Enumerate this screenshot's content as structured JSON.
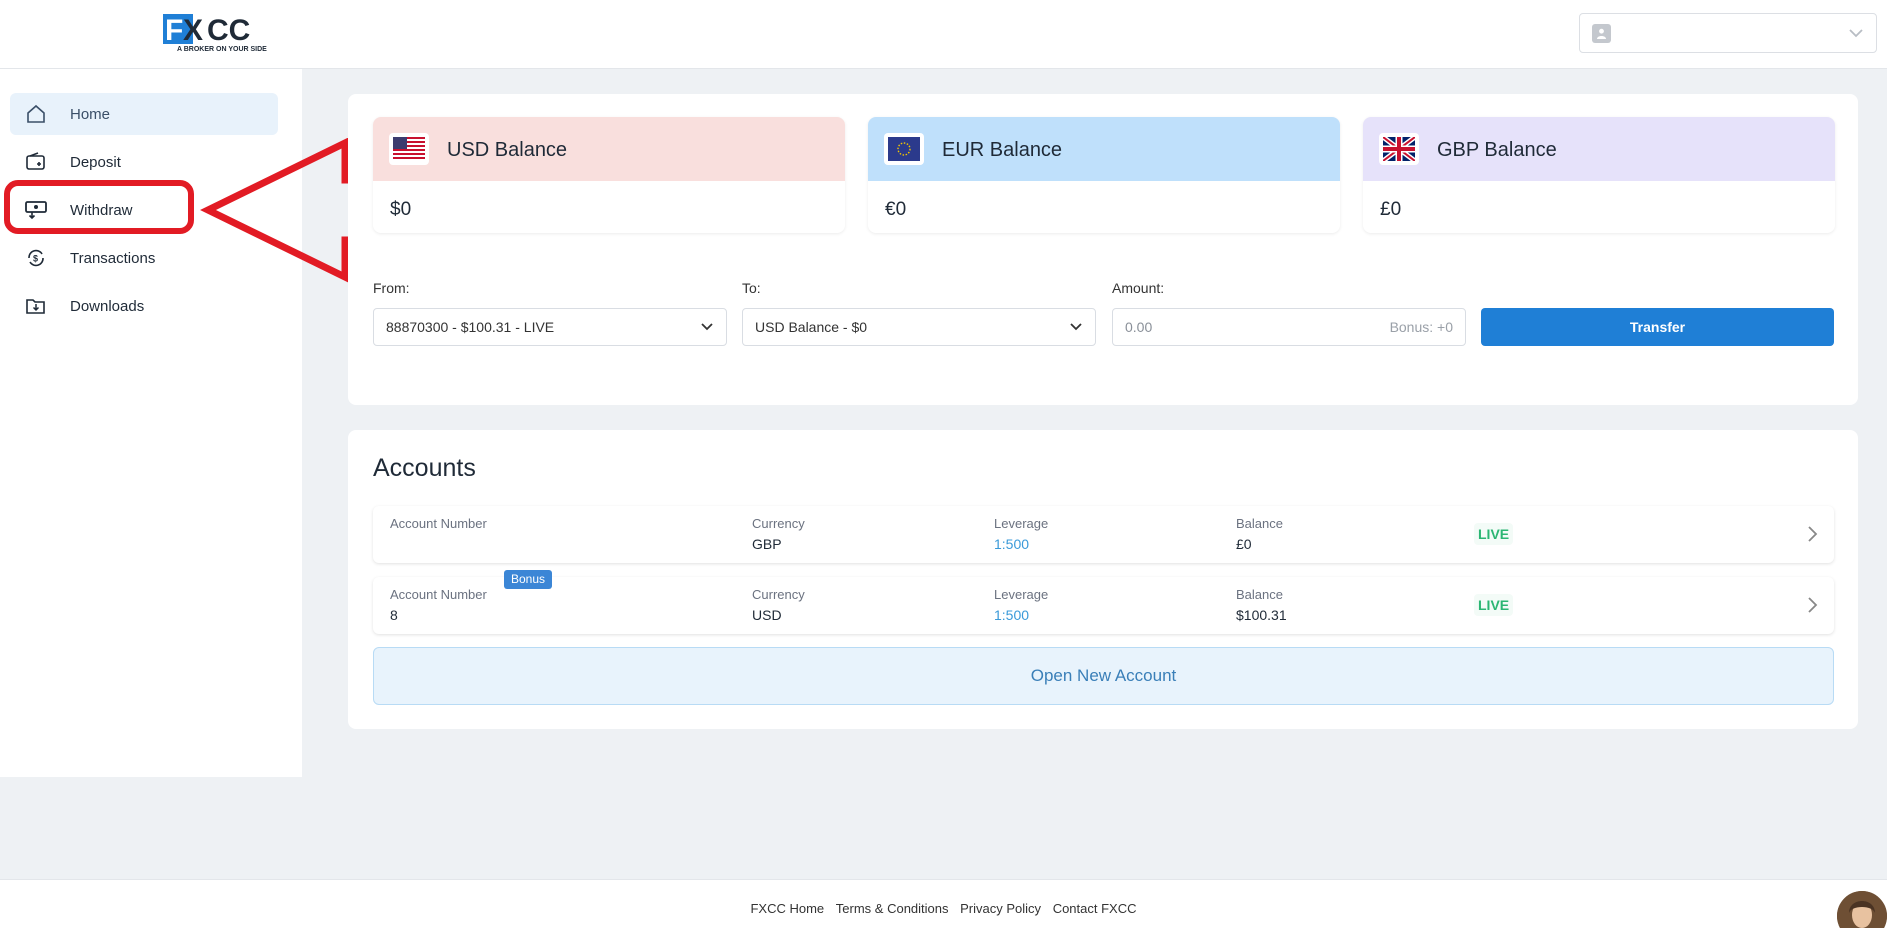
{
  "brand": {
    "logo_text": "FXCC",
    "tagline": "A BROKER ON YOUR SIDE",
    "primary_color": "#1f7fd6"
  },
  "sidebar": {
    "items": [
      {
        "label": "Home",
        "icon": "home-icon",
        "active": true
      },
      {
        "label": "Deposit",
        "icon": "wallet-icon",
        "active": false
      },
      {
        "label": "Withdraw",
        "icon": "withdraw-icon",
        "active": false
      },
      {
        "label": "Transactions",
        "icon": "transactions-icon",
        "active": false
      },
      {
        "label": "Downloads",
        "icon": "download-folder-icon",
        "active": false
      }
    ]
  },
  "balances": [
    {
      "title": "USD Balance",
      "value": "$0",
      "flag": "us-flag-icon",
      "color": "#f9dfdd"
    },
    {
      "title": "EUR Balance",
      "value": "€0",
      "flag": "eu-flag-icon",
      "color": "#bfe0fb"
    },
    {
      "title": "GBP Balance",
      "value": "£0",
      "flag": "uk-flag-icon",
      "color": "#e6e2fa"
    }
  ],
  "transfer": {
    "from_label": "From:",
    "from_value": "88870300 - $100.31 - LIVE",
    "to_label": "To:",
    "to_value": "USD Balance - $0",
    "amount_label": "Amount:",
    "amount_placeholder": "0.00",
    "bonus_text": "Bonus: +0",
    "button_label": "Transfer"
  },
  "accounts": {
    "title": "Accounts",
    "labels": {
      "number": "Account Number",
      "currency": "Currency",
      "leverage": "Leverage",
      "balance": "Balance"
    },
    "rows": [
      {
        "number": "",
        "currency": "GBP",
        "leverage": "1:500",
        "balance": "£0",
        "status": "LIVE",
        "bonus": ""
      },
      {
        "number": "8",
        "currency": "USD",
        "leverage": "1:500",
        "balance": "$100.31",
        "status": "LIVE",
        "bonus": "Bonus"
      }
    ],
    "open_button": "Open New Account"
  },
  "footer": {
    "links": [
      "FXCC Home",
      "Terms & Conditions",
      "Privacy Policy",
      "Contact FXCC"
    ]
  },
  "annotation_color": "#e21b24"
}
